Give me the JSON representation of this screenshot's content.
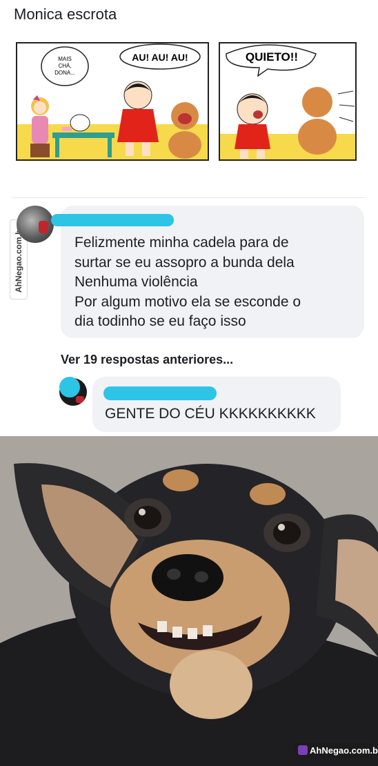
{
  "post": {
    "title": "Monica escrota"
  },
  "comic": {
    "panel1": {
      "small_bubble": [
        "MAIS",
        "CHÁ,",
        "DONA..."
      ],
      "bark_bubble": "AU! AU! AU!"
    },
    "panel2": {
      "bubble": "QUIETO!!"
    }
  },
  "comment": {
    "lines": [
      "Felizmente minha cadela para de",
      "surtar se eu assopro a bunda dela",
      "Nenhuma violência",
      "Por algum motivo ela se esconde o",
      "dia todinho se eu faço isso"
    ]
  },
  "view_replies": {
    "label": "Ver 19 respostas anteriores..."
  },
  "reply": {
    "text": "GENTE DO CÉU KKKKKKKKKK"
  },
  "watermark": {
    "side": "AhNegao.com.br",
    "bottom": "AhNegao.com.br"
  },
  "colors": {
    "redaction": "#2ec4e6",
    "comment_bg": "#f0f2f5",
    "comic_yellow": "#f7d94c"
  },
  "icons": {
    "photo_subject": "dog-photo"
  }
}
